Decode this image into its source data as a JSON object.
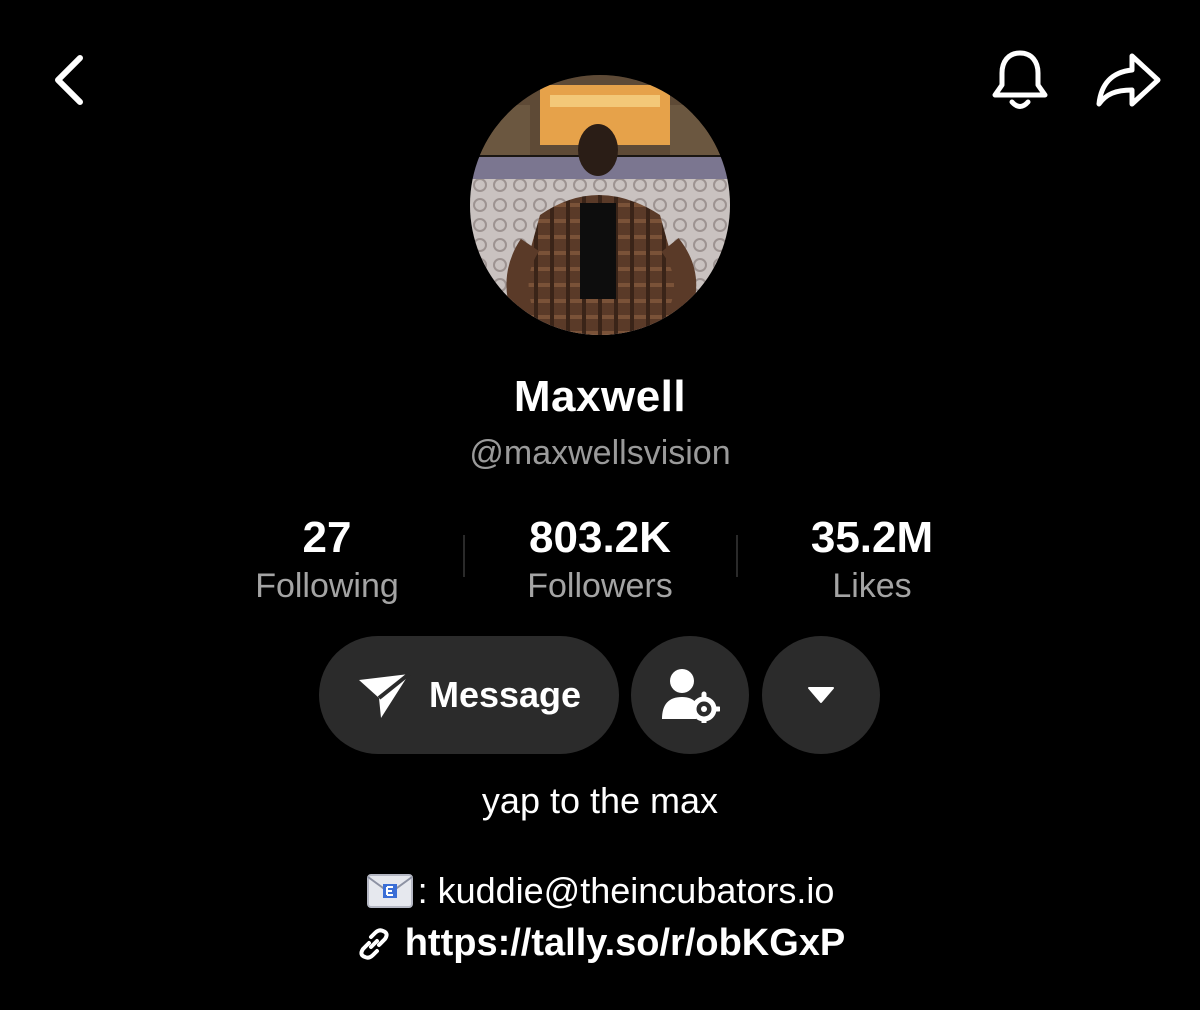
{
  "header": {
    "back_icon": "chevron-left-icon",
    "notifications_icon": "bell-icon",
    "share_icon": "share-arrow-icon"
  },
  "profile": {
    "avatar_icon": "profile-photo",
    "display_name": "Maxwell",
    "username": "@maxwellsvision"
  },
  "stats": [
    {
      "value": "27",
      "label": "Following"
    },
    {
      "value": "803.2K",
      "label": "Followers"
    },
    {
      "value": "35.2M",
      "label": "Likes"
    }
  ],
  "actions": {
    "message_label": "Message",
    "message_icon": "paper-plane-icon",
    "friend_settings_icon": "user-gear-icon",
    "more_icon": "caret-down-icon"
  },
  "bio": {
    "text": "yap to the max",
    "email_prefix": ": kuddie@theincubators.io",
    "email_icon": "envelope-icon",
    "link_icon": "link-icon",
    "link": "https://tally.so/r/obKGxP"
  },
  "colors": {
    "background": "#000000",
    "button_bg": "#2b2b2b",
    "secondary_text": "#9a9a9a"
  }
}
